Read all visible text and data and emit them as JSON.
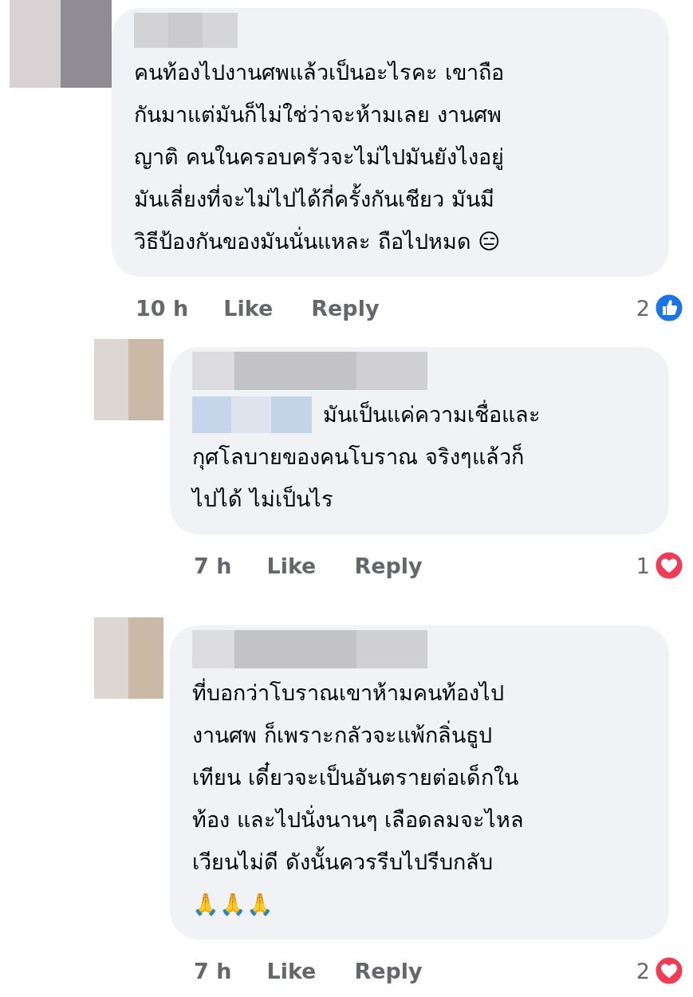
{
  "comments": [
    {
      "reply": false,
      "text": "คนท้องไปงานศพแล้วเป็นอะไรคะ เขาถือ\nกันมาแต่มันก็ไม่ใช่ว่าจะห้ามเลย งานศพ\nญาติ คนในครอบครัวจะไม่ไปมันยังไงอยู่\nมันเลี่ยงที่จะไม่ไปได้กี่ครั้งกันเชียว มันมี\nวิธีป้องกันของมันนั่นแหละ ถือไปหมด 😑",
      "mention": false,
      "time": "10 h",
      "like": "Like",
      "reply_label": "Reply",
      "reaction": {
        "kind": "like",
        "count": "2"
      }
    },
    {
      "reply": true,
      "text": "มันเป็นแค่ความเชื่อและ\nกุศโลบายของคนโบราณ จริงๆแล้วก็\nไปได้ ไม่เป็นไร",
      "mention": true,
      "time": "7 h",
      "like": "Like",
      "reply_label": "Reply",
      "reaction": {
        "kind": "love",
        "count": "1"
      }
    },
    {
      "reply": true,
      "text": "ที่บอกว่าโบราณเขาห้ามคนท้องไป\nงานศพ ก็เพราะกลัวจะแพ้กลิ่นธูป\nเทียน เดี๋ยวจะเป็นอันตรายต่อเด็กใน\nท้อง และไปนั่งนานๆ เลือดลมจะไหล\nเวียนไม่ดี ดังนั้นควรรีบไปรีบกลับ\n🙏🙏🙏",
      "mention": false,
      "time": "7 h",
      "like": "Like",
      "reply_label": "Reply",
      "reaction": {
        "kind": "love",
        "count": "2"
      }
    }
  ]
}
